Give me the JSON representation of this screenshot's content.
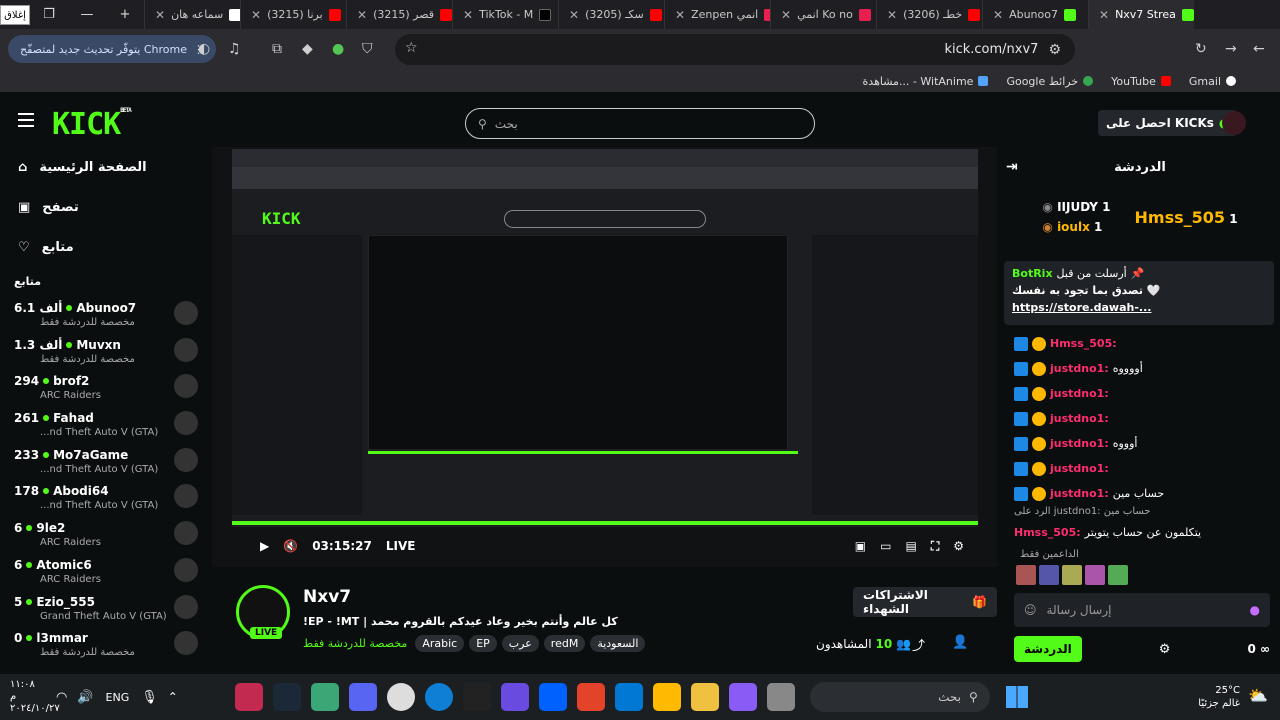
{
  "tabs": [
    {
      "title": "إغلاق",
      "color": "#ffffff"
    },
    {
      "title": "سماعه هان",
      "color": "#ffffff"
    },
    {
      "title": "(3215) برنا",
      "color": "#ff0000"
    },
    {
      "title": "(3215) قصر",
      "color": "#ff0000"
    },
    {
      "title": "TikTok - M",
      "color": "#000000"
    },
    {
      "title": "(3205) سكـ",
      "color": "#ff0000"
    },
    {
      "title": "Zenpen انمي",
      "color": "#e9204f"
    },
    {
      "title": "انمي Ko no",
      "color": "#e9204f"
    },
    {
      "title": "(3206) خطـ",
      "color": "#ff0000"
    },
    {
      "title": "Abunoo7",
      "color": "#53fc18"
    },
    {
      "title": "Nxv7 Strea",
      "color": "#53fc18"
    }
  ],
  "address": {
    "url": "kick.com/nxv7",
    "update_label": "يتوفّر تحديث جديد لمتصفّح Chrome"
  },
  "bookmarks": [
    "Gmail",
    "YouTube",
    "Google خرائط",
    "مشاهدة... - WitAnime"
  ],
  "kick": {
    "search_placeholder": "بحث",
    "get_kicks": "احصل على KICKs",
    "nav": [
      "الصفحة الرئيسية",
      "تصفح",
      "متابع"
    ],
    "follow_label": "متابع",
    "following": [
      {
        "count": "6.1 ألف",
        "name": "Abunoo7",
        "sub": "مخصصة للدردشة فقط"
      },
      {
        "count": "1.3 ألف",
        "name": "Muvxn",
        "sub": "مخصصة للدردشة فقط"
      },
      {
        "count": "294",
        "name": "brof2",
        "sub": "ARC Raiders"
      },
      {
        "count": "261",
        "name": "Fahad",
        "sub": "...nd Theft Auto V (GTA)"
      },
      {
        "count": "233",
        "name": "Mo7aGame",
        "sub": "...nd Theft Auto V (GTA)"
      },
      {
        "count": "178",
        "name": "Abodi64",
        "sub": "...nd Theft Auto V (GTA)"
      },
      {
        "count": "6",
        "name": "9le2",
        "sub": "ARC Raiders"
      },
      {
        "count": "6",
        "name": "Atomic6",
        "sub": "ARC Raiders"
      },
      {
        "count": "5",
        "name": "Ezio_555",
        "sub": "Grand Theft Auto V (GTA)"
      },
      {
        "count": "0",
        "name": "l3mmar",
        "sub": "مخصصة للدردشة فقط"
      }
    ],
    "video": {
      "time": "03:15:27",
      "live": "LIVE"
    },
    "stream": {
      "name": "Nxv7",
      "title": "!EP - !MT | كل عالم وأنتم بخير وعاد عيدكم بالقروم محمد",
      "category": "مخصصة للدردشة فقط",
      "tags": [
        "Arabic",
        "EP",
        "عرب",
        "redM",
        "السعودية"
      ],
      "viewers": "10",
      "viewers_label": "المشاهدون",
      "subs_button": "الاشتراكات الشهداء",
      "live": "LIVE"
    },
    "chat": {
      "title": "الدردشة",
      "top": [
        {
          "rank": "1",
          "name": "Hmss_505",
          "sub": "1"
        },
        {
          "rank": "2",
          "name": "IIJUDY",
          "sub": "1"
        },
        {
          "rank": "3",
          "name": "ioulx",
          "sub": "1"
        }
      ],
      "pinned": {
        "user": "BotRix",
        "by": "أرسلت من قبل",
        "text": "تصدق بما تجود به نفسك 🤍",
        "link": "https://store.dawah-..."
      },
      "messages": [
        {
          "user": "Hmss_505:",
          "text": "",
          "color": "#ff2d6f"
        },
        {
          "user": "justdno1:",
          "text": "أووووه",
          "color": "#ff2d6f"
        },
        {
          "user": "justdno1:",
          "text": "",
          "color": "#ff2d6f"
        },
        {
          "user": "justdno1:",
          "text": "",
          "color": "#ff2d6f"
        },
        {
          "user": "justdno1:",
          "text": "أوووه",
          "color": "#ff2d6f"
        },
        {
          "user": "justdno1:",
          "text": "",
          "color": "#ff2d6f"
        },
        {
          "user": "justdno1:",
          "text": "حساب مين",
          "color": "#ff2d6f"
        }
      ],
      "reply": "الرد على justdno1: حساب مين",
      "last": {
        "user": "Hmss_505:",
        "text": "يتكلمون عن حساب يتويتر"
      },
      "supporters_label": "الداعمين فقط",
      "input_placeholder": "إرسال رسالة",
      "send": "الدردشة",
      "points": "0"
    }
  },
  "taskbar": {
    "search": "بحث",
    "weather": "25°C",
    "weather_sub": "غالم جزئيًا",
    "lang": "ENG",
    "time": "١١:٠٨ م",
    "date": "٢٠٢٤/١٠/٢٧"
  }
}
